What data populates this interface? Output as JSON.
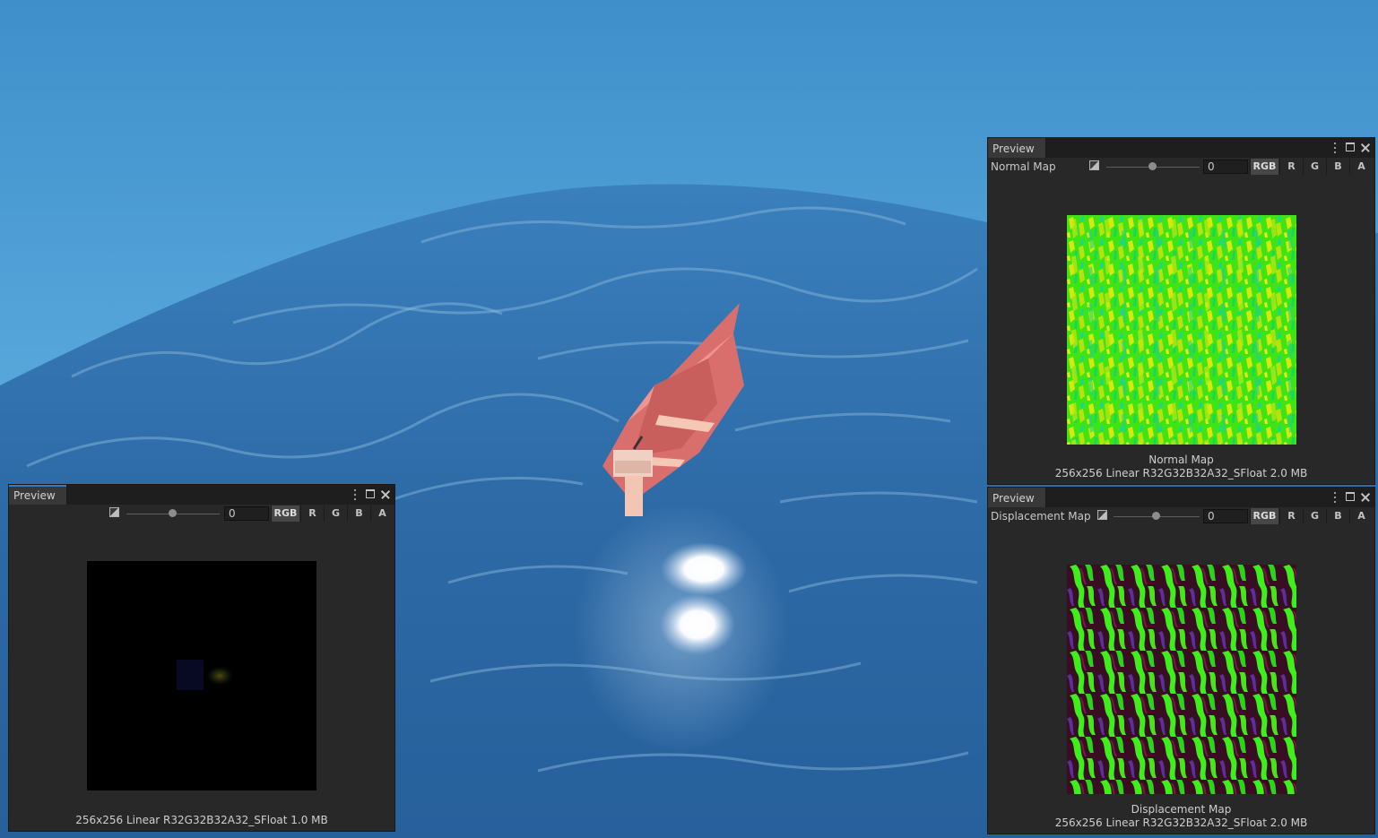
{
  "scene": {
    "description_icons": [
      "ocean-water",
      "rowboat"
    ]
  },
  "previews": {
    "left": {
      "tab_title": "Preview",
      "map_label": "",
      "exposure_value": "0",
      "channels": [
        "RGB",
        "R",
        "G",
        "B",
        "A"
      ],
      "active_channel": "RGB",
      "texture_name": "",
      "texture_info": "256x256 Linear  R32G32B32A32_SFloat  1.0 MB"
    },
    "normal": {
      "tab_title": "Preview",
      "map_label": "Normal Map",
      "exposure_value": "0",
      "channels": [
        "RGB",
        "R",
        "G",
        "B",
        "A"
      ],
      "active_channel": "RGB",
      "texture_name": "Normal Map",
      "texture_info": "256x256 Linear  R32G32B32A32_SFloat  2.0 MB"
    },
    "displacement": {
      "tab_title": "Preview",
      "map_label": "Displacement Map",
      "exposure_value": "0",
      "channels": [
        "RGB",
        "R",
        "G",
        "B",
        "A"
      ],
      "active_channel": "RGB",
      "texture_name": "Displacement Map",
      "texture_info": "256x256 Linear  R32G32B32A32_SFloat  2.0 MB"
    }
  },
  "colors": {
    "sky": "#4a9ad1",
    "ocean": "#2f6fa8",
    "boat": "#e2807c",
    "window_bg": "#282828",
    "accent": "#3a79bb"
  }
}
